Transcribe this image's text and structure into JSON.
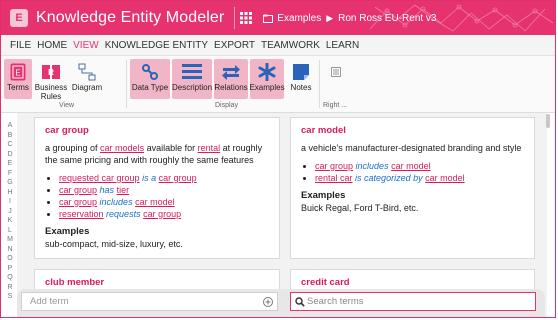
{
  "app": {
    "title": "Knowledge Entity Modeler",
    "logo_letter": "E",
    "breadcrumb": [
      "Examples",
      "Ron Ross EU-Rent v3"
    ],
    "brand_color": "#e6336f"
  },
  "menu": [
    "FILE",
    "HOME",
    "VIEW",
    "KNOWLEDGE ENTITY",
    "EXPORT",
    "TEAMWORK",
    "LEARN"
  ],
  "menu_active": "VIEW",
  "ribbon": {
    "view_group": {
      "label": "View",
      "buttons": [
        {
          "label": "Terms",
          "icon": "terms-icon",
          "active": true
        },
        {
          "label": "Business Rules",
          "icon": "business-rules-icon",
          "active": false
        },
        {
          "label": "Diagram",
          "icon": "diagram-icon",
          "active": false
        }
      ]
    },
    "display_group": {
      "label": "Display",
      "buttons": [
        {
          "label": "Data Type",
          "icon": "data-type-icon",
          "active": true
        },
        {
          "label": "Description",
          "icon": "description-icon",
          "active": true
        },
        {
          "label": "Relations",
          "icon": "relations-icon",
          "active": true
        },
        {
          "label": "Examples",
          "icon": "examples-icon",
          "active": true
        },
        {
          "label": "Notes",
          "icon": "notes-icon",
          "active": false
        }
      ]
    },
    "right_group": {
      "label": "Right ..."
    }
  },
  "alphabet": [
    "A",
    "B",
    "C",
    "D",
    "E",
    "F",
    "G",
    "H",
    "I",
    "J",
    "K",
    "L",
    "M",
    "N",
    "O",
    "P",
    "Q",
    "R",
    "S"
  ],
  "cards": {
    "car_group": {
      "term": "car group",
      "desc_parts": [
        "a grouping of ",
        "car models",
        " available for ",
        "rental",
        " at roughly the same pricing and with roughly the same features"
      ],
      "relations": [
        {
          "subject": "requested car group",
          "verb": "is a",
          "object": "car group"
        },
        {
          "subject": "car group",
          "verb": "has",
          "object": "tier"
        },
        {
          "subject": "car group",
          "verb": "includes",
          "object": "car model"
        },
        {
          "subject": "reservation",
          "verb": "requests",
          "object": "car group"
        }
      ],
      "examples_heading": "Examples",
      "examples": "sub-compact, mid-size, luxury, etc."
    },
    "car_model": {
      "term": "car model",
      "desc": "a vehicle's manufacturer-designated branding and style",
      "relations": [
        {
          "subject": "car group",
          "verb": "includes",
          "object": "car model"
        },
        {
          "subject": "rental car",
          "verb": "is categorized by",
          "object": "car model"
        }
      ],
      "examples_heading": "Examples",
      "examples": "Buick Regal, Ford T-Bird, etc."
    },
    "club_member": {
      "term": "club member"
    },
    "credit_card": {
      "term": "credit card"
    }
  },
  "bottom": {
    "add_term_placeholder": "Add term",
    "search_placeholder": "Search terms"
  }
}
